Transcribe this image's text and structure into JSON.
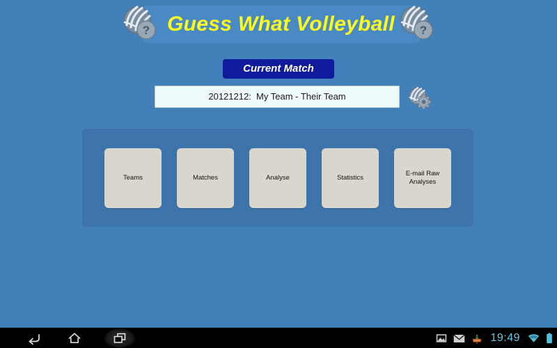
{
  "app": {
    "title": "Guess What Volleyball",
    "background_color": "#4180b8",
    "title_panel_color": "#4a8ac4",
    "title_text_color": "#fcfb1e"
  },
  "header": {
    "title": "Guess What Volleyball",
    "icon_left": "volleyball-question-icon",
    "icon_right": "volleyball-question-icon"
  },
  "current_match": {
    "button_label": "Current Match",
    "button_color": "#0f1a9c",
    "field_value": "20121212:  My Team - Their Team",
    "field_placeholder": "",
    "settings_icon": "volleyball-gear-icon"
  },
  "menu": {
    "panel_color": "#3d74ab",
    "button_color": "#d9d6cf",
    "buttons": [
      {
        "label": "Teams",
        "name": "teams"
      },
      {
        "label": "Matches",
        "name": "matches"
      },
      {
        "label": "Analyse",
        "name": "analyse"
      },
      {
        "label": "Statistics",
        "name": "statistics"
      },
      {
        "label": "E-mail Raw\nAnalyses",
        "name": "email-raw-analyses"
      }
    ]
  },
  "system_bar": {
    "background_color": "#000000",
    "nav": [
      {
        "name": "back",
        "icon": "back-arrow-icon"
      },
      {
        "name": "home",
        "icon": "home-icon"
      },
      {
        "name": "recents",
        "icon": "recent-apps-icon"
      }
    ],
    "status": {
      "icons": [
        {
          "name": "screenshot",
          "icon": "image-icon"
        },
        {
          "name": "email",
          "icon": "envelope-icon"
        },
        {
          "name": "app-notification",
          "icon": "app-notification-icon"
        }
      ],
      "clock": "19:49",
      "clock_color": "#64c8e6",
      "wifi_icon": "wifi-icon",
      "battery_icon": "battery-full-icon"
    }
  }
}
